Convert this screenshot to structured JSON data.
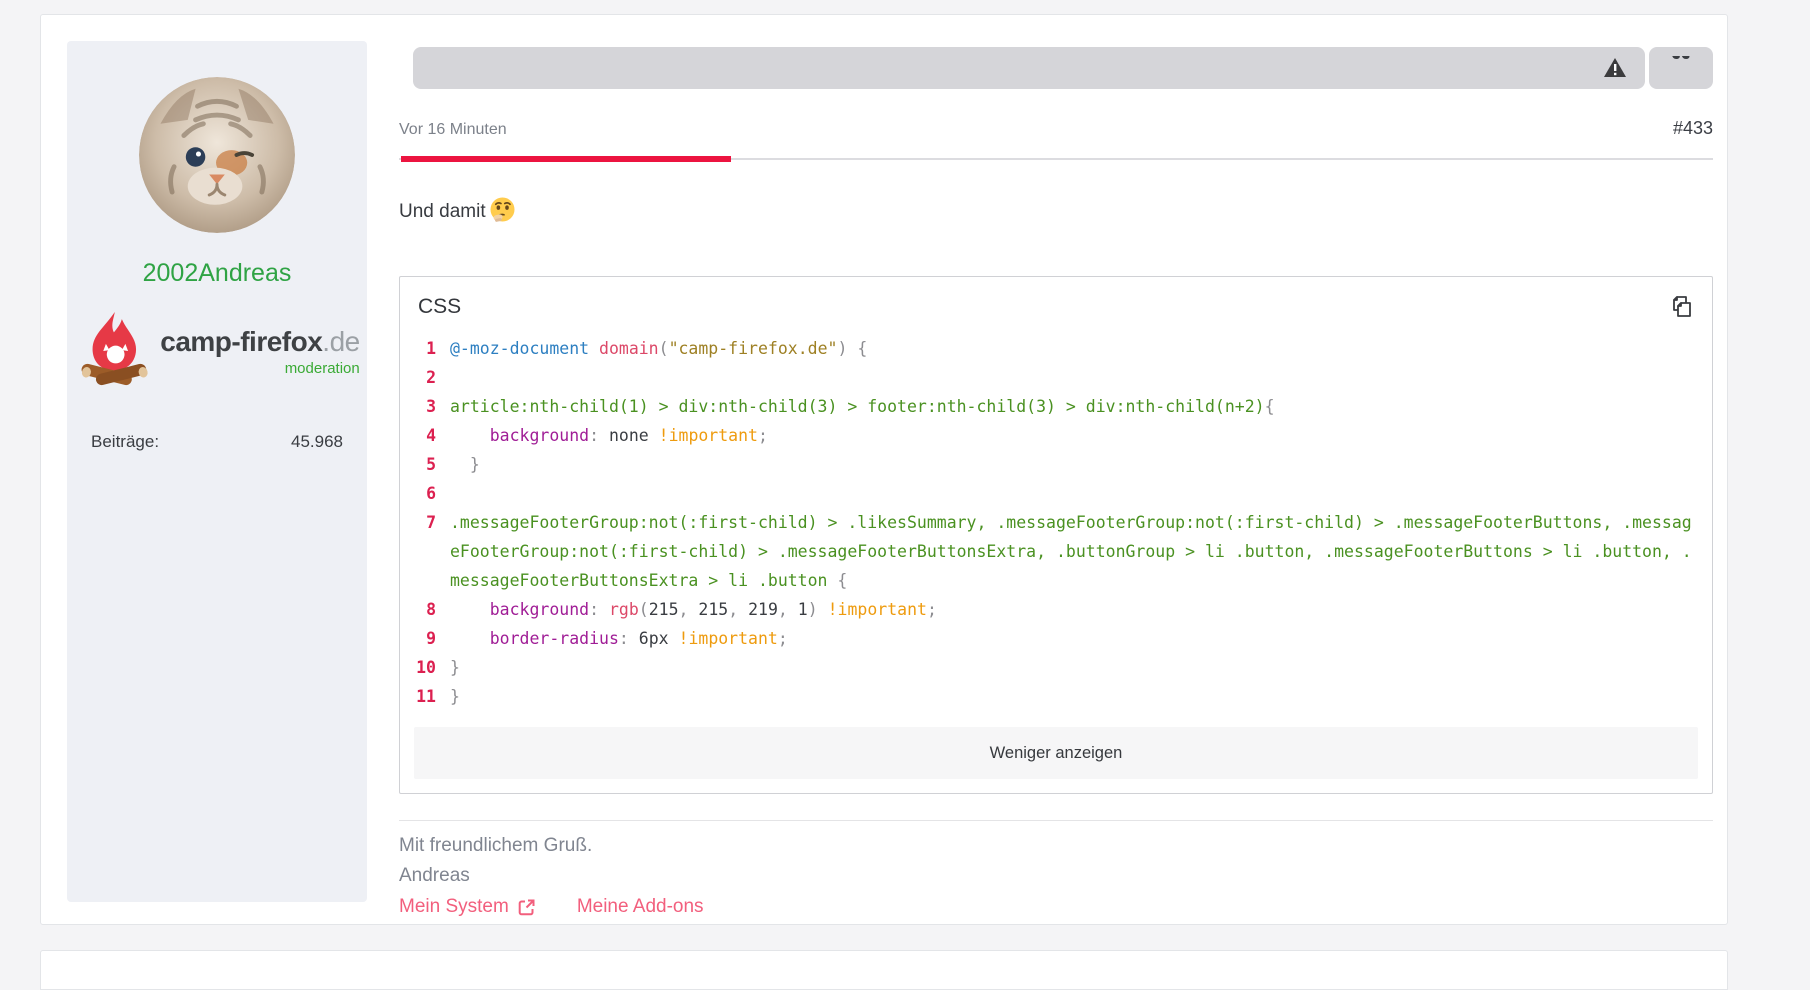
{
  "colors": {
    "accent_red": "#ec1440",
    "link_pink": "#f25f7d",
    "username_green": "#2fa344",
    "moderation_green": "#3aaa35"
  },
  "sidebar": {
    "username": "2002Andreas",
    "logo": {
      "brand": "camp-firefox",
      "tld": ".de",
      "role": "moderation"
    },
    "stats": {
      "label": "Beiträge:",
      "value": "45.968"
    }
  },
  "post": {
    "timestamp": "Vor 16 Minuten",
    "number": "#433",
    "body": "Und damit",
    "emoji_name": "thinking-face",
    "code": {
      "label": "CSS",
      "collapse_label": "Weniger anzeigen",
      "lines": [
        {
          "n": "1",
          "seg": [
            [
              "at",
              "@-moz-document"
            ],
            [
              "pl",
              " "
            ],
            [
              "fn",
              "domain"
            ],
            [
              "pu",
              "("
            ],
            [
              "st",
              "\"camp-firefox.de\""
            ],
            [
              "pu",
              ")"
            ],
            [
              "pl",
              " "
            ],
            [
              "pu",
              "{"
            ]
          ]
        },
        {
          "n": "2",
          "seg": []
        },
        {
          "n": "3",
          "seg": [
            [
              "se",
              "article:nth-child(1) > div:nth-child(3) > footer:nth-child(3) > div:nth-child(n+2)"
            ],
            [
              "pu",
              "{"
            ]
          ]
        },
        {
          "n": "4",
          "seg": [
            [
              "pl",
              "    "
            ],
            [
              "pr",
              "background"
            ],
            [
              "pu",
              ":"
            ],
            [
              "va",
              " none "
            ],
            [
              "im",
              "!important"
            ],
            [
              "pu",
              ";"
            ]
          ]
        },
        {
          "n": "5",
          "seg": [
            [
              "pu",
              "  }"
            ]
          ]
        },
        {
          "n": "6",
          "seg": []
        },
        {
          "n": "7",
          "seg": [
            [
              "se",
              ".messageFooterGroup:not(:first-child) > .likesSummary, .messageFooterGroup:not(:first-child) > .messageFooterButtons, .messageFooterGroup:not(:first-child) > .messageFooterButtonsExtra, .buttonGroup > li .button, .messageFooterButtons > li .button, .messageFooterButtonsExtra > li .button "
            ],
            [
              "pu",
              "{"
            ]
          ]
        },
        {
          "n": "8",
          "seg": [
            [
              "pl",
              "    "
            ],
            [
              "pr",
              "background"
            ],
            [
              "pu",
              ": "
            ],
            [
              "fn",
              "rgb"
            ],
            [
              "pu",
              "("
            ],
            [
              "va",
              "215"
            ],
            [
              "pu",
              ", "
            ],
            [
              "va",
              "215"
            ],
            [
              "pu",
              ", "
            ],
            [
              "va",
              "219"
            ],
            [
              "pu",
              ", "
            ],
            [
              "va",
              "1"
            ],
            [
              "pu",
              ") "
            ],
            [
              "im",
              "!important"
            ],
            [
              "pu",
              ";"
            ]
          ]
        },
        {
          "n": "9",
          "seg": [
            [
              "pl",
              "    "
            ],
            [
              "pr",
              "border-radius"
            ],
            [
              "pu",
              ": "
            ],
            [
              "va",
              "6px "
            ],
            [
              "im",
              "!important"
            ],
            [
              "pu",
              ";"
            ]
          ]
        },
        {
          "n": "10",
          "seg": [
            [
              "pu",
              "}"
            ]
          ]
        },
        {
          "n": "11",
          "seg": [
            [
              "pu",
              "}"
            ]
          ]
        }
      ]
    },
    "signature": {
      "greeting": "Mit freundlichem Gruß.",
      "name": "Andreas",
      "links": [
        {
          "label": "Mein System"
        },
        {
          "label": "Meine Add-ons"
        }
      ]
    }
  }
}
